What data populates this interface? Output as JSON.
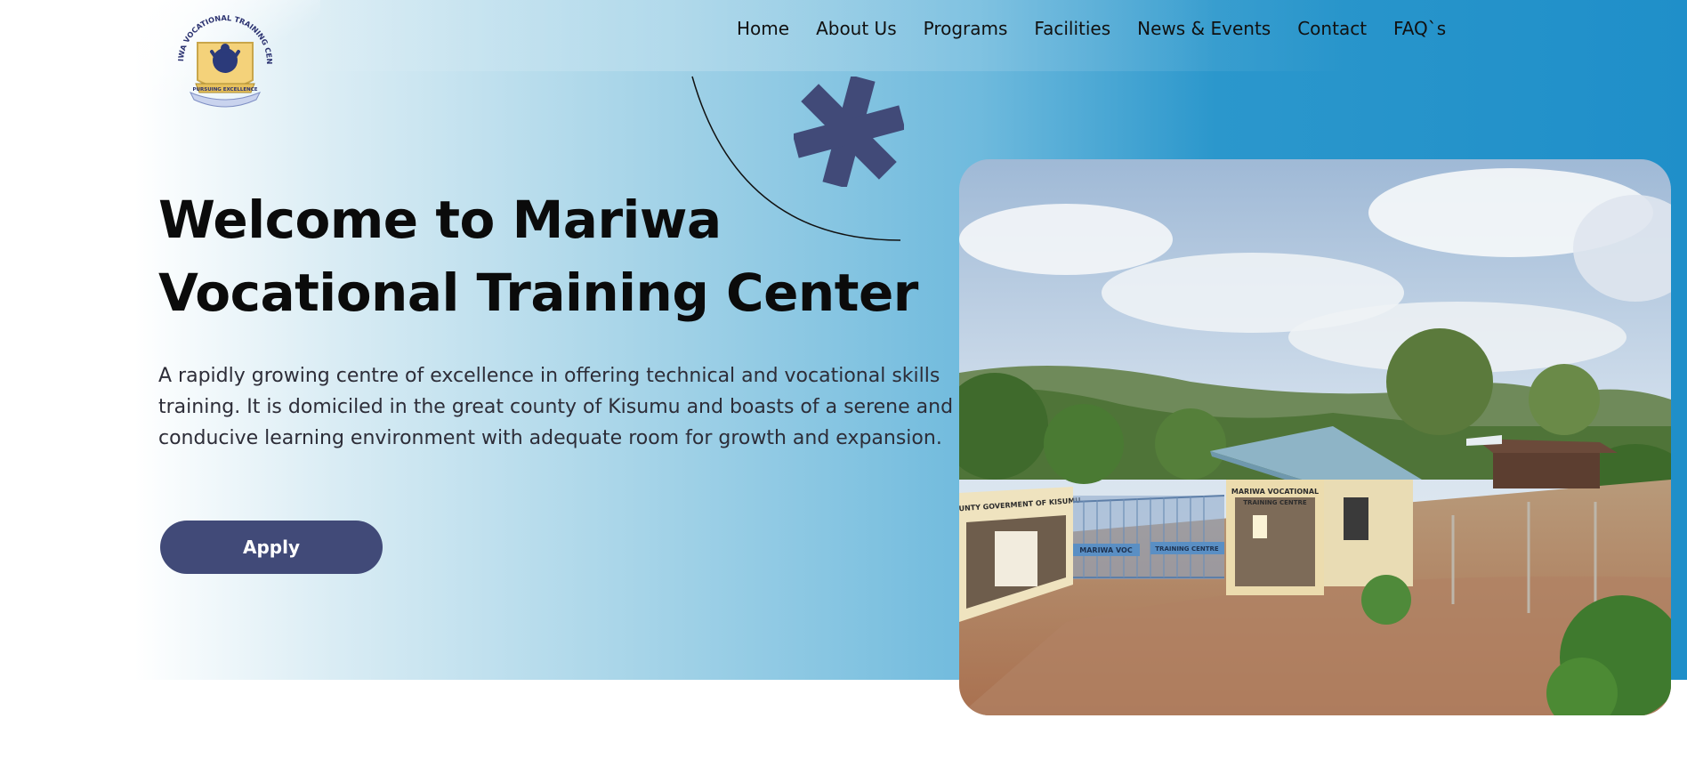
{
  "logo": {
    "arc_text": "MARIWA VOCATIONAL TRAINING CENTRE",
    "motto": "PURSUING EXCELLENCE"
  },
  "nav": {
    "items": [
      {
        "label": "Home"
      },
      {
        "label": "About Us"
      },
      {
        "label": "Programs"
      },
      {
        "label": "Facilities"
      },
      {
        "label": "News & Events"
      },
      {
        "label": "Contact"
      },
      {
        "label": "FAQ`s"
      }
    ]
  },
  "hero": {
    "title_line1": "Welcome to Mariwa",
    "title_line2": "Vocational Training Center",
    "description": "A rapidly growing centre of excellence in offering technical and vocational skills training. It is domiciled in the great county of Kisumu and boasts of a serene and conducive learning environment with adequate room for growth and expansion.",
    "apply_label": "Apply"
  },
  "photo": {
    "wall_sign": "COUNTY GOVERMENT OF KISUMU",
    "gate_sign_left": "MARIWA VOC",
    "gate_sign_right": "TRAINING CENTRE",
    "house_sign_line1": "MARIWA VOCATIONAL",
    "house_sign_line2": "TRAINING CENTRE"
  },
  "colors": {
    "accent": "#414a78",
    "hero_blue": "#1f8fc9",
    "text": "#0b0b0b"
  }
}
